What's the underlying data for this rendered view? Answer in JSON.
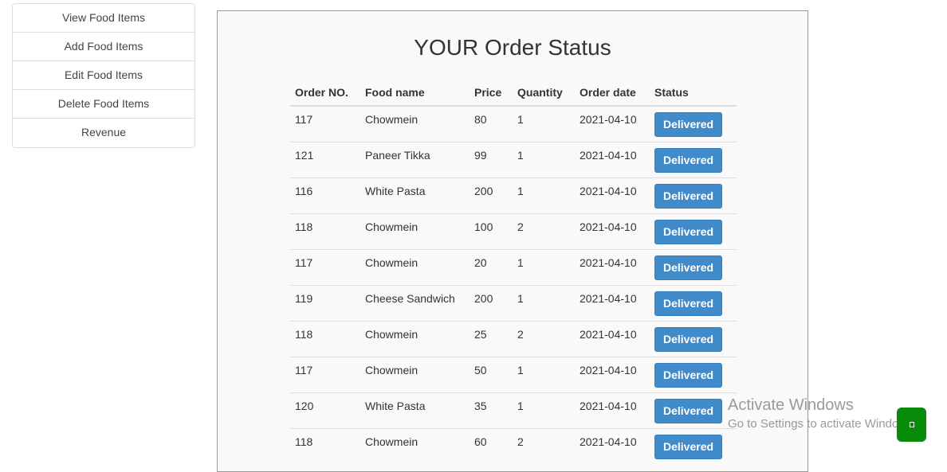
{
  "sidebar": {
    "items": [
      {
        "label": "View Food Items"
      },
      {
        "label": "Add Food Items"
      },
      {
        "label": "Edit Food Items"
      },
      {
        "label": "Delete Food Items"
      },
      {
        "label": "Revenue"
      }
    ]
  },
  "main": {
    "title": "YOUR Order Status",
    "columns": [
      "Order NO.",
      "Food name",
      "Price",
      "Quantity",
      "Order date",
      "Status"
    ],
    "rows": [
      {
        "order_no": "117",
        "food_name": "Chowmein",
        "price": "80",
        "quantity": "1",
        "order_date": "2021-04-10",
        "status": "Delivered"
      },
      {
        "order_no": "121",
        "food_name": "Paneer Tikka",
        "price": "99",
        "quantity": "1",
        "order_date": "2021-04-10",
        "status": "Delivered"
      },
      {
        "order_no": "116",
        "food_name": "White Pasta",
        "price": "200",
        "quantity": "1",
        "order_date": "2021-04-10",
        "status": "Delivered"
      },
      {
        "order_no": "118",
        "food_name": "Chowmein",
        "price": "100",
        "quantity": "2",
        "order_date": "2021-04-10",
        "status": "Delivered"
      },
      {
        "order_no": "117",
        "food_name": "Chowmein",
        "price": "20",
        "quantity": "1",
        "order_date": "2021-04-10",
        "status": "Delivered"
      },
      {
        "order_no": "119",
        "food_name": "Cheese Sandwich",
        "price": "200",
        "quantity": "1",
        "order_date": "2021-04-10",
        "status": "Delivered"
      },
      {
        "order_no": "118",
        "food_name": "Chowmein",
        "price": "25",
        "quantity": "2",
        "order_date": "2021-04-10",
        "status": "Delivered"
      },
      {
        "order_no": "117",
        "food_name": "Chowmein",
        "price": "50",
        "quantity": "1",
        "order_date": "2021-04-10",
        "status": "Delivered"
      },
      {
        "order_no": "120",
        "food_name": "White Pasta",
        "price": "35",
        "quantity": "1",
        "order_date": "2021-04-10",
        "status": "Delivered"
      },
      {
        "order_no": "118",
        "food_name": "Chowmein",
        "price": "60",
        "quantity": "2",
        "order_date": "2021-04-10",
        "status": "Delivered"
      }
    ]
  },
  "watermark": {
    "title": "Activate Windows",
    "subtitle": "Go to Settings to activate Windows."
  },
  "chat_button": {
    "icon": "chat-icon"
  },
  "colors": {
    "status_button": "#428bca",
    "chat_button": "#0a8a0a",
    "panel_background": "#f9f9f9"
  }
}
